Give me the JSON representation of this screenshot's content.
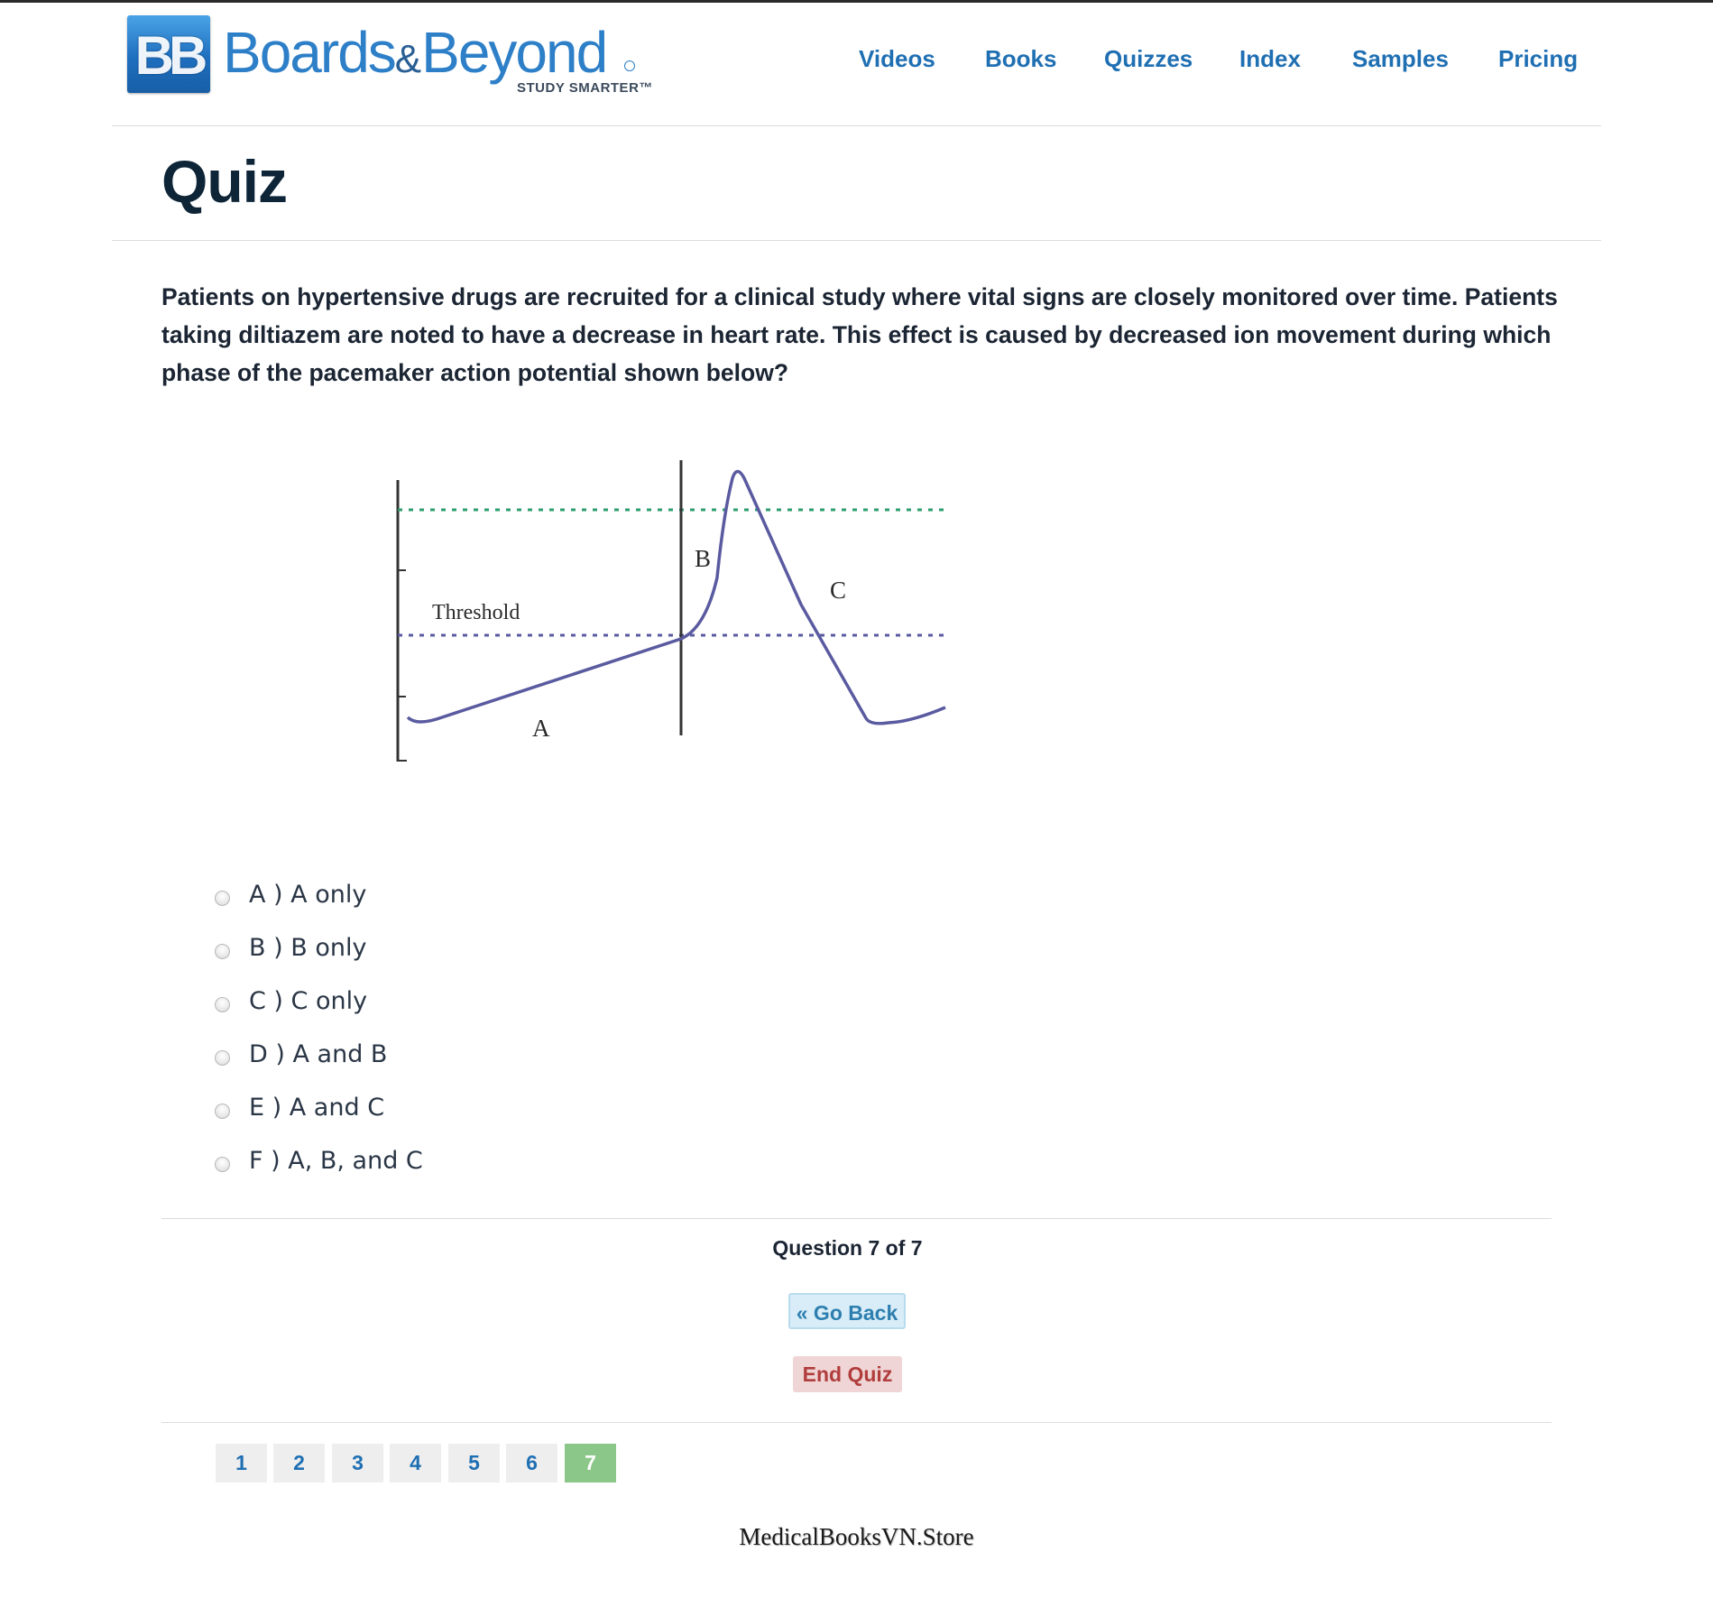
{
  "brand": {
    "badge": "BB",
    "name_part1": "Boards",
    "name_amp": "&",
    "name_part2": "Beyond",
    "tagline": "STUDY SMARTER™"
  },
  "nav": {
    "items": [
      {
        "label": "Videos"
      },
      {
        "label": "Books"
      },
      {
        "label": "Quizzes"
      },
      {
        "label": "Index"
      },
      {
        "label": "Samples"
      },
      {
        "label": "Pricing"
      }
    ]
  },
  "page": {
    "title": "Quiz"
  },
  "question": {
    "text": "Patients on hypertensive drugs are recruited for a clinical study where vital signs are closely monitored over time. Patients taking diltiazem are noted to have a decrease in heart rate. This effect is caused by decreased ion movement during which phase of the pacemaker action potential shown below?"
  },
  "figure": {
    "threshold_label": "Threshold",
    "phase_a": "A",
    "phase_b": "B",
    "phase_c": "C",
    "colors": {
      "curve": "#5a5aa0",
      "top_line": "#2e9e6e",
      "threshold_line": "#5a5aa0",
      "axis": "#333333"
    }
  },
  "options": [
    {
      "label": "A ) A only",
      "selected": false
    },
    {
      "label": "B ) B only",
      "selected": false
    },
    {
      "label": "C ) C only",
      "selected": false
    },
    {
      "label": "D ) A and B",
      "selected": false
    },
    {
      "label": "E ) A and C",
      "selected": false
    },
    {
      "label": "F ) A, B, and C",
      "selected": false
    }
  ],
  "progress": {
    "text": "Question 7 of 7",
    "current": 7,
    "total": 7
  },
  "buttons": {
    "back": "« Go Back",
    "end": "End Quiz"
  },
  "pagination": {
    "pages": [
      "1",
      "2",
      "3",
      "4",
      "5",
      "6",
      "7"
    ],
    "active": "7"
  },
  "watermark": "MedicalBooksVN.Store",
  "colors": {
    "link": "#1f6fb3",
    "active_page": "#8cc78a",
    "end_button": "#efd5d5",
    "back_button": "#d8edf7"
  }
}
